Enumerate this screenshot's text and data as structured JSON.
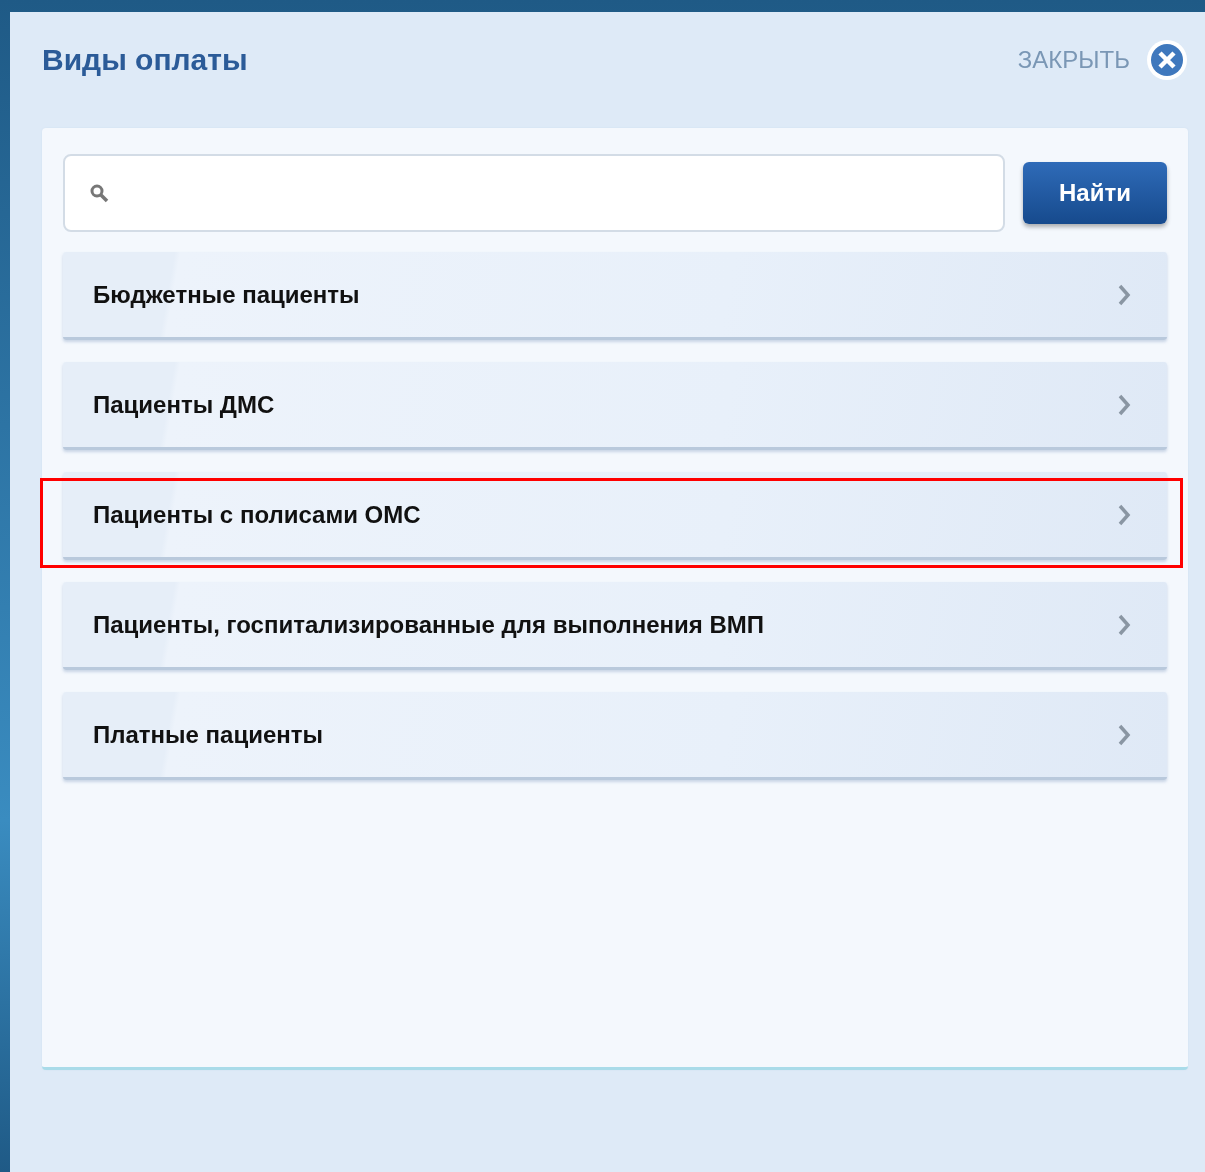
{
  "dialog": {
    "title": "Виды оплаты",
    "close_label": "ЗАКРЫТЬ"
  },
  "search": {
    "button": "Найти"
  },
  "items": [
    {
      "label": "Бюджетные пациенты",
      "highlighted": false
    },
    {
      "label": "Пациенты ДМС",
      "highlighted": false
    },
    {
      "label": "Пациенты с полисами ОМС",
      "highlighted": true
    },
    {
      "label": "Пациенты, госпитализированные для выполнения ВМП",
      "highlighted": false
    },
    {
      "label": "Платные пациенты",
      "highlighted": false
    }
  ]
}
